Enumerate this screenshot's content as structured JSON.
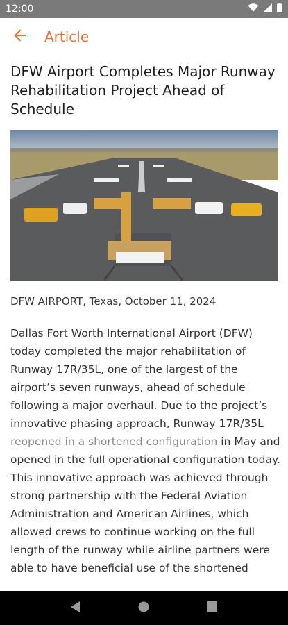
{
  "status_bar": {
    "time": "12:00"
  },
  "app_bar": {
    "title": "Article"
  },
  "article": {
    "headline": "DFW Airport Completes Major Runway Rehabilitation Project Ahead of Schedule",
    "dateline": "DFW AIRPORT, Texas, October 11, 2024",
    "body_part1": "Dallas Fort Worth International Airport (DFW) today completed the major rehabilitation of Runway 17R/35L, one of the largest of the airport’s seven runways, ahead of schedule following a major overhaul. Due to the project’s innovative phasing approach, Runway 17R/35L ",
    "body_link": "reopened in a shortened configuration",
    "body_part2": " in May and opened in the full operational configuration today. This innovative approach was achieved through strong partnership with the Federal Aviation Administration and American Airlines, which allowed crews to continue working on the full length of the runway while airline partners were able to have beneficial use of the shortened"
  },
  "colors": {
    "accent": "#e8733a",
    "status_bar": "#7a7a7a",
    "link": "#8a8a8a"
  },
  "icons": [
    "wifi-icon",
    "cellular-signal-icon",
    "battery-icon",
    "back-arrow-icon",
    "nav-back-icon",
    "nav-home-icon",
    "nav-recents-icon"
  ]
}
